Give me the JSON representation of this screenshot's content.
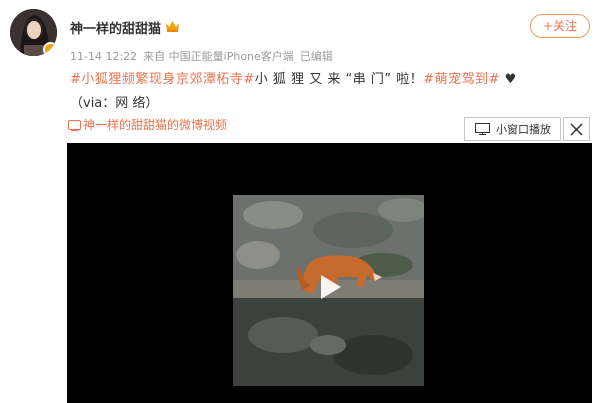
{
  "user": {
    "name": "神一样的甜甜猫"
  },
  "follow": {
    "label": "+关注"
  },
  "meta": {
    "time": "11-14 12:22",
    "source": "来自 中国正能量iPhone客户端",
    "edited": "已编辑"
  },
  "post": {
    "tag1": "#小狐狸频繁现身京郊潭柘寺#",
    "body": "小 狐 狸 又 来 “串 门” 啦！",
    "tag2": "#萌宠驾到#",
    "heart": "♥",
    "via": "（via：网 络）"
  },
  "video_link": {
    "label": "神一样的甜甜猫的微博视频"
  },
  "video": {
    "mini_window_label": "小窗口播放"
  },
  "colors": {
    "accent": "#eb7350",
    "follow_border": "#f29a5f",
    "video_bg": "#000000"
  }
}
